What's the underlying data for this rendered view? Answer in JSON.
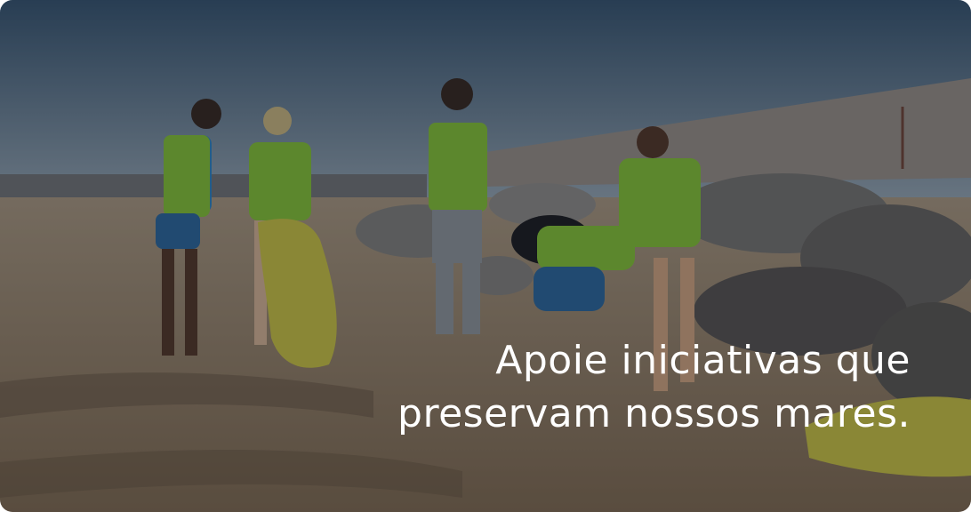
{
  "banner": {
    "headline_line1": "Apoie iniciativas que",
    "headline_line2": "preservam nossos mares."
  },
  "colors": {
    "sky_top": "#3b5a78",
    "sky_bottom": "#9fb2c2",
    "sand": "#a08a70",
    "vest": "#8fd13a",
    "shirt": "#2f8fd1",
    "bag": "#d8d04a"
  }
}
